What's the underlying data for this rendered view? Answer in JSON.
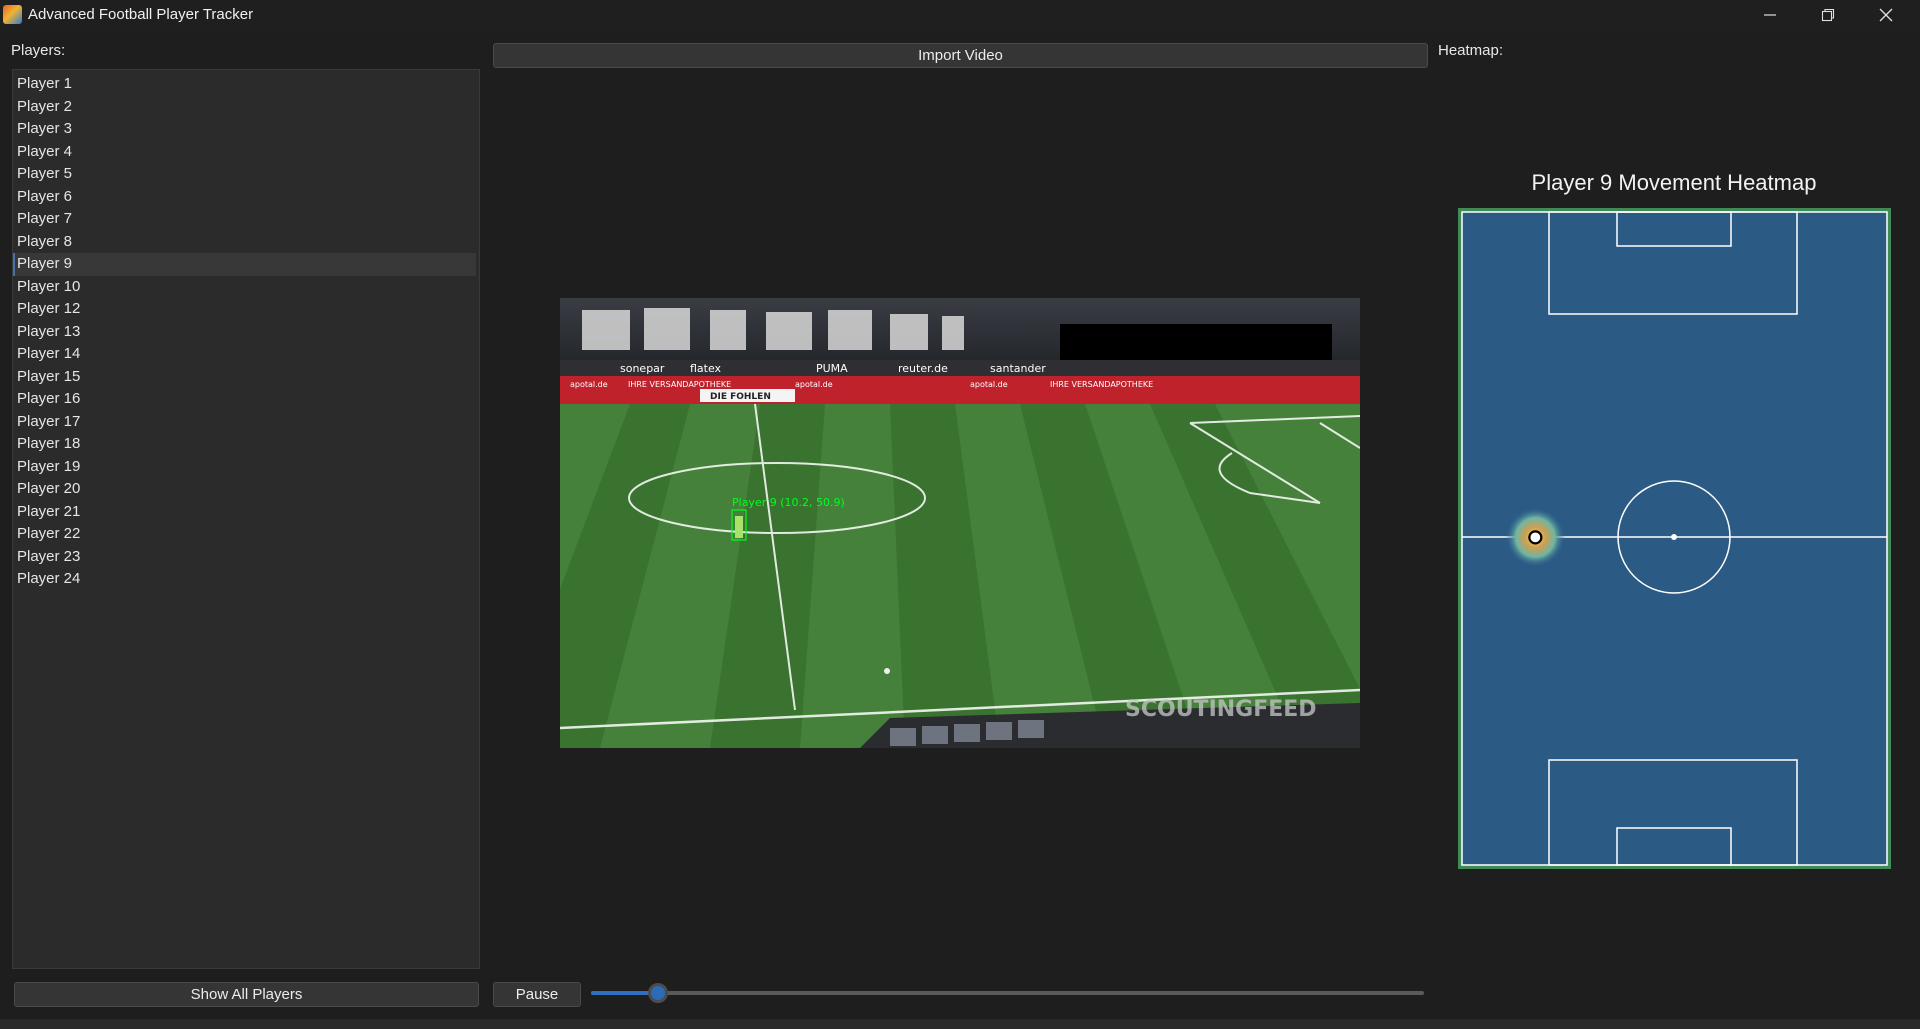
{
  "window": {
    "title": "Advanced Football Player Tracker",
    "icons": {
      "app": "app-logo-icon",
      "minimize": "minimize-icon",
      "maximize": "restore-icon",
      "close": "close-icon"
    }
  },
  "players_panel": {
    "label": "Players:",
    "items": [
      "Player 1",
      "Player 2",
      "Player 3",
      "Player 4",
      "Player 5",
      "Player 6",
      "Player 7",
      "Player 8",
      "Player 9",
      "Player 10",
      "Player 12",
      "Player 13",
      "Player 14",
      "Player 15",
      "Player 16",
      "Player 17",
      "Player 18",
      "Player 19",
      "Player 20",
      "Player 21",
      "Player 22",
      "Player 23",
      "Player 24"
    ],
    "selected": "Player 9",
    "show_all_label": "Show All Players"
  },
  "video_panel": {
    "import_label": "Import Video",
    "pause_label": "Pause",
    "frame": {
      "player_overlay_label": "Player 9 (10.2, 50.9)",
      "watermark": "SCOUTINGFEED",
      "ad_texts": [
        "sonepar",
        "flatex",
        "PUMA",
        "reuter.de",
        "santander",
        "apotal.de",
        "IHRE VERSANDAPOTHEKE",
        "DIE FOHLEN"
      ],
      "colors": {
        "overlay": "#00ff1e",
        "grass_light": "#4d8a3a",
        "grass_dark": "#3b7430"
      }
    },
    "playback_position": 0.08
  },
  "heatmap_panel": {
    "label": "Heatmap:",
    "title": "Player 9 Movement Heatmap",
    "hotspot": {
      "x": 10.2,
      "y": 50.9
    },
    "colors": {
      "pitch": "#2b5a85",
      "lines": "#ffffff",
      "border": "#3f8a55"
    }
  }
}
